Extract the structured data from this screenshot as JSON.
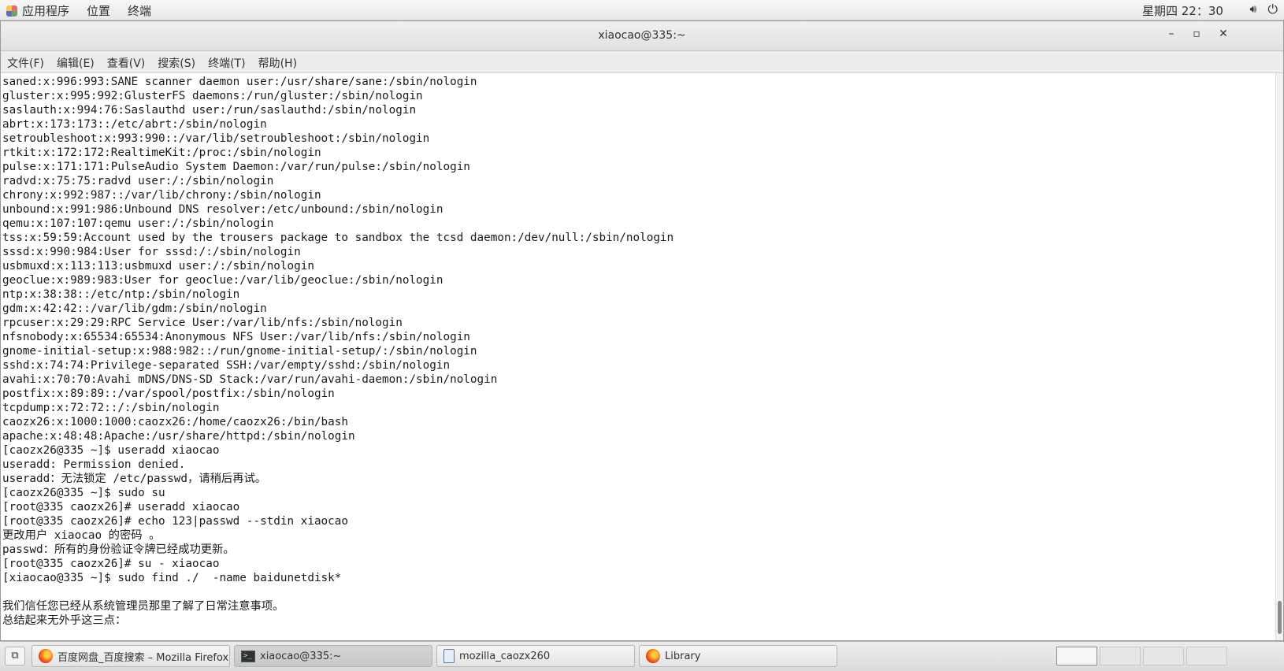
{
  "topbar": {
    "menus": [
      "应用程序",
      "位置",
      "终端"
    ],
    "clock": "星期四 22：30",
    "icons": [
      "app-menu-icon",
      "volume-icon",
      "power-icon"
    ]
  },
  "window": {
    "title": "xiaocao@335:~",
    "controls": {
      "minimize": "–",
      "maximize": "▫",
      "close": "✕"
    },
    "menubar": [
      "文件(F)",
      "编辑(E)",
      "查看(V)",
      "搜索(S)",
      "终端(T)",
      "帮助(H)"
    ]
  },
  "terminal": {
    "lines": [
      "saned:x:996:993:SANE scanner daemon user:/usr/share/sane:/sbin/nologin",
      "gluster:x:995:992:GlusterFS daemons:/run/gluster:/sbin/nologin",
      "saslauth:x:994:76:Saslauthd user:/run/saslauthd:/sbin/nologin",
      "abrt:x:173:173::/etc/abrt:/sbin/nologin",
      "setroubleshoot:x:993:990::/var/lib/setroubleshoot:/sbin/nologin",
      "rtkit:x:172:172:RealtimeKit:/proc:/sbin/nologin",
      "pulse:x:171:171:PulseAudio System Daemon:/var/run/pulse:/sbin/nologin",
      "radvd:x:75:75:radvd user:/:/sbin/nologin",
      "chrony:x:992:987::/var/lib/chrony:/sbin/nologin",
      "unbound:x:991:986:Unbound DNS resolver:/etc/unbound:/sbin/nologin",
      "qemu:x:107:107:qemu user:/:/sbin/nologin",
      "tss:x:59:59:Account used by the trousers package to sandbox the tcsd daemon:/dev/null:/sbin/nologin",
      "sssd:x:990:984:User for sssd:/:/sbin/nologin",
      "usbmuxd:x:113:113:usbmuxd user:/:/sbin/nologin",
      "geoclue:x:989:983:User for geoclue:/var/lib/geoclue:/sbin/nologin",
      "ntp:x:38:38::/etc/ntp:/sbin/nologin",
      "gdm:x:42:42::/var/lib/gdm:/sbin/nologin",
      "rpcuser:x:29:29:RPC Service User:/var/lib/nfs:/sbin/nologin",
      "nfsnobody:x:65534:65534:Anonymous NFS User:/var/lib/nfs:/sbin/nologin",
      "gnome-initial-setup:x:988:982::/run/gnome-initial-setup/:/sbin/nologin",
      "sshd:x:74:74:Privilege-separated SSH:/var/empty/sshd:/sbin/nologin",
      "avahi:x:70:70:Avahi mDNS/DNS-SD Stack:/var/run/avahi-daemon:/sbin/nologin",
      "postfix:x:89:89::/var/spool/postfix:/sbin/nologin",
      "tcpdump:x:72:72::/:/sbin/nologin",
      "caozx26:x:1000:1000:caozx26:/home/caozx26:/bin/bash",
      "apache:x:48:48:Apache:/usr/share/httpd:/sbin/nologin",
      "[caozx26@335 ~]$ useradd xiaocao",
      "useradd: Permission denied.",
      "useradd：无法锁定 /etc/passwd，请稍后再试。",
      "[caozx26@335 ~]$ sudo su",
      "[root@335 caozx26]# useradd xiaocao",
      "[root@335 caozx26]# echo 123|passwd --stdin xiaocao",
      "更改用户 xiaocao 的密码 。",
      "passwd：所有的身份验证令牌已经成功更新。",
      "[root@335 caozx26]# su - xiaocao",
      "[xiaocao@335 ~]$ sudo find ./  -name baidunetdisk*",
      "",
      "我们信任您已经从系统管理员那里了解了日常注意事项。",
      "总结起来无外乎这三点："
    ]
  },
  "taskbar": {
    "show_desktop_icon": "show-desktop-icon",
    "tasks": [
      {
        "label": "百度网盘_百度搜索 – Mozilla Firefox",
        "icon": "firefox-icon"
      },
      {
        "label": "xiaocao@335:~",
        "icon": "terminal-icon"
      },
      {
        "label": "mozilla_caozx260",
        "icon": "document-icon"
      },
      {
        "label": "Library",
        "icon": "firefox-icon"
      }
    ],
    "active_task": 1,
    "workspaces": 4,
    "active_workspace": 1
  }
}
